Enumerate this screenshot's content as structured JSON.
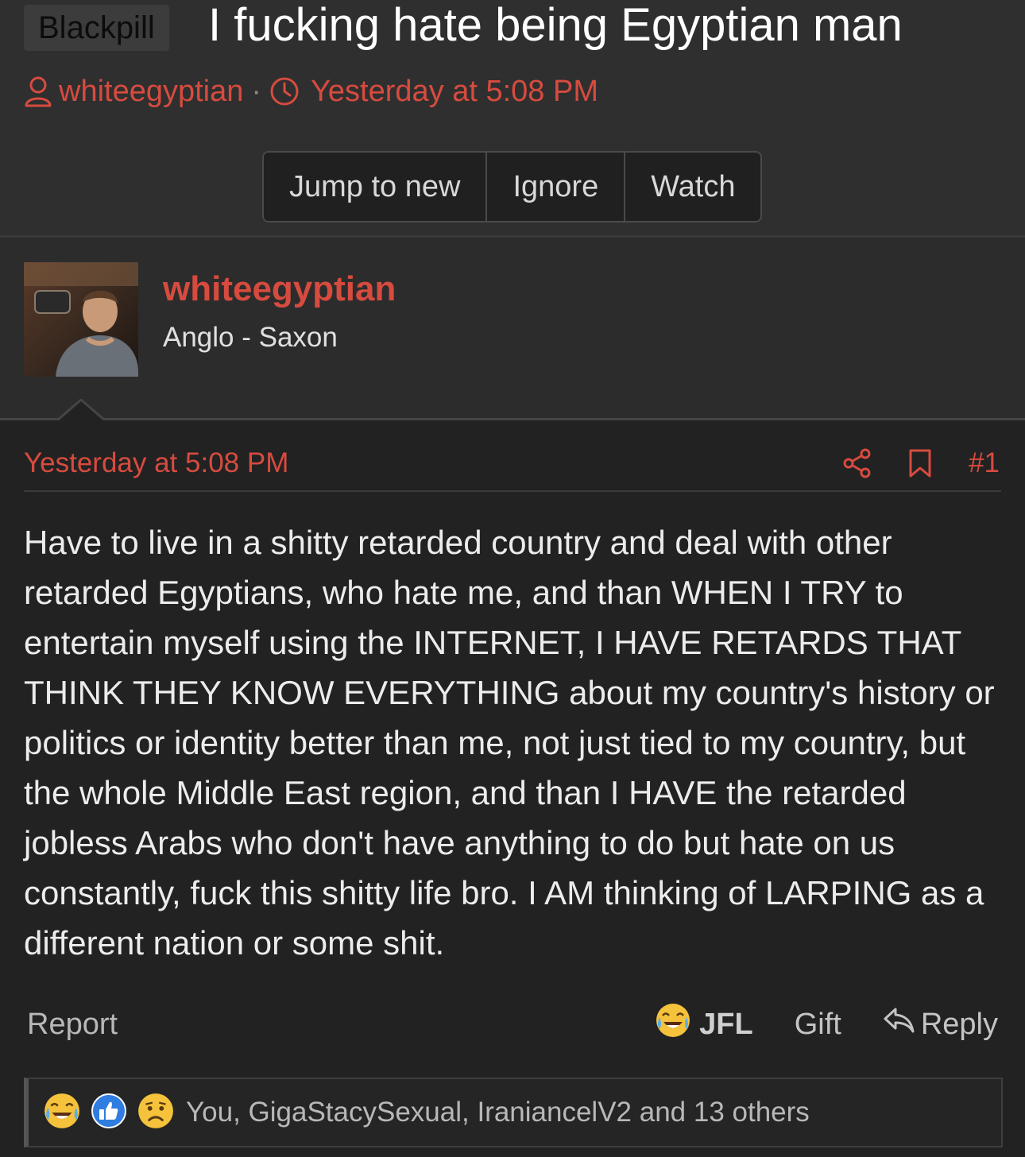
{
  "thread": {
    "prefix": "Blackpill",
    "title": "I fucking hate being Egyptian man",
    "author": "whiteegyptian",
    "separator": "·",
    "date": "Yesterday at 5:08 PM",
    "buttons": {
      "jump_to_new": "Jump to new",
      "ignore": "Ignore",
      "watch": "Watch"
    }
  },
  "author_block": {
    "name": "whiteegyptian",
    "title": "Anglo - Saxon"
  },
  "post": {
    "date": "Yesterday at 5:08 PM",
    "number": "#1",
    "body": "Have to live in a shitty retarded country and deal with other retarded Egyptians, who hate me, and than WHEN I TRY to entertain myself using the INTERNET, I HAVE RETARDS THAT THINK THEY KNOW EVERYTHING about my country's history or politics or identity better than me, not just tied to my country, but the whole Middle East region, and than I HAVE the retarded jobless Arabs who don't have anything to do but hate on us constantly, fuck this shitty life bro. I AM thinking of LARPING as a different nation or some shit.",
    "footer": {
      "report": "Report",
      "reaction": "JFL",
      "gift": "Gift",
      "reply": "Reply"
    },
    "reactions_summary": "You, GigaStacySexual, IraniancelV2 and 13 others"
  },
  "colors": {
    "accent": "#d74b3f",
    "background": "#2c2c2c",
    "post_background": "#222222"
  },
  "icons": [
    "user-icon",
    "clock-icon",
    "share-icon",
    "bookmark-icon",
    "joy-emoji-icon",
    "reply-icon",
    "like-icon",
    "sad-emoji-icon"
  ]
}
